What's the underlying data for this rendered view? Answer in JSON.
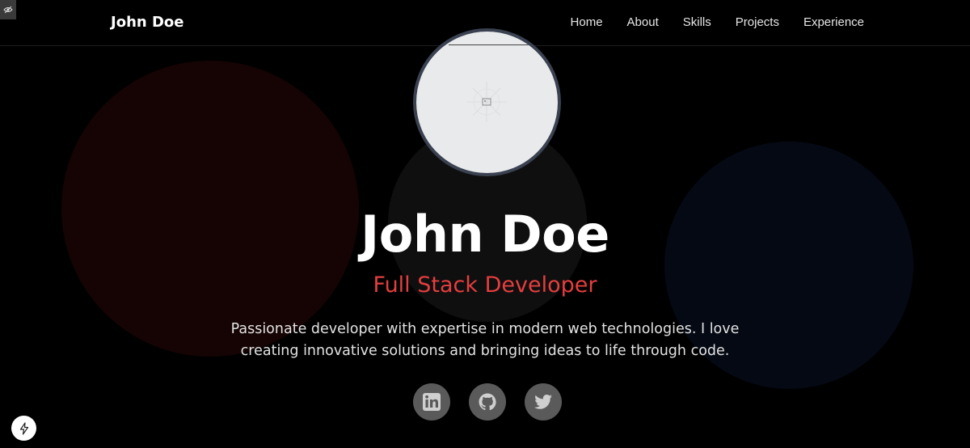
{
  "navbar": {
    "brand": "John Doe",
    "links": [
      "Home",
      "About",
      "Skills",
      "Projects",
      "Experience"
    ]
  },
  "hero": {
    "name": "John Doe",
    "role": "Full Stack Developer",
    "description": "Passionate developer with expertise in modern web technologies. I love creating innovative solutions and bringing ideas to life through code."
  },
  "socials": [
    {
      "icon": "linkedin-icon"
    },
    {
      "icon": "github-icon"
    },
    {
      "icon": "twitter-icon"
    }
  ],
  "colors": {
    "background": "#000000",
    "accent": "#e53e3e",
    "social_bg": "#5a5a5a",
    "blob_red": "#160404",
    "blob_blue": "#050914"
  }
}
